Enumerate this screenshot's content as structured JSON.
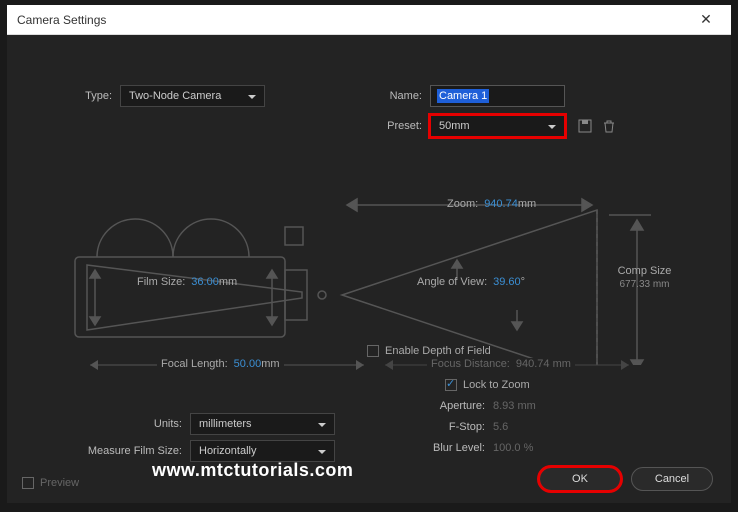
{
  "titlebar": {
    "title": "Camera Settings"
  },
  "fields": {
    "type_label": "Type:",
    "type_value": "Two-Node Camera",
    "name_label": "Name:",
    "name_value": "Camera 1",
    "preset_label": "Preset:",
    "preset_value": "50mm",
    "zoom_label": "Zoom:",
    "zoom_value": "940.74",
    "zoom_unit": " mm",
    "film_size_label": "Film Size:",
    "film_size_value": "36.00",
    "film_size_unit": " mm",
    "angle_label": "Angle of View:",
    "angle_value": "39.60",
    "angle_unit": " °",
    "comp_size_label": "Comp Size",
    "comp_size_value": "677.33 mm",
    "focal_label": "Focal Length:",
    "focal_value": "50.00",
    "focal_unit": " mm",
    "enable_dof_label": "Enable Depth of Field",
    "focus_dist_label": "Focus Distance:",
    "focus_dist_value": "940.74 mm",
    "lock_zoom_label": "Lock to Zoom",
    "aperture_label": "Aperture:",
    "aperture_value": "8.93 mm",
    "fstop_label": "F-Stop:",
    "fstop_value": "5.6",
    "blur_label": "Blur Level:",
    "blur_value": "100.0 %",
    "units_label": "Units:",
    "units_value": "millimeters",
    "measure_label": "Measure Film Size:",
    "measure_value": "Horizontally"
  },
  "footer": {
    "preview_label": "Preview",
    "ok_label": "OK",
    "cancel_label": "Cancel"
  },
  "watermark": "www.mtctutorials.com"
}
